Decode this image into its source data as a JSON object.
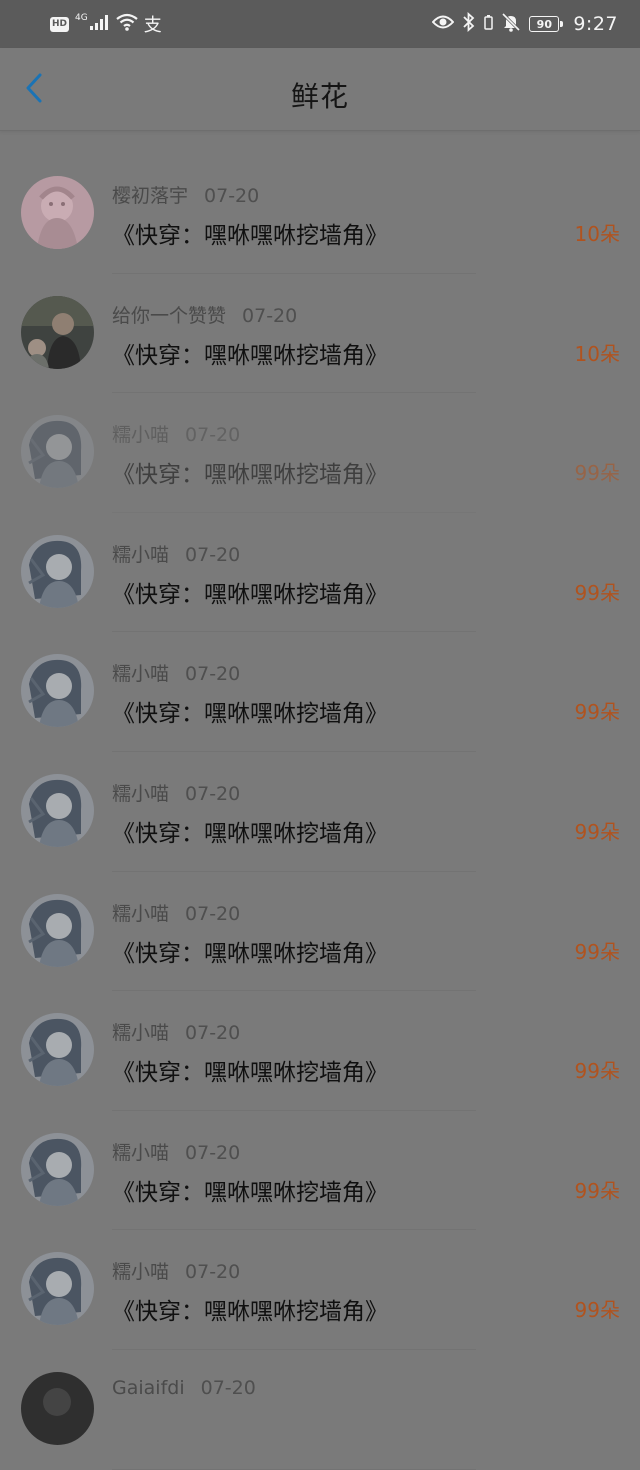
{
  "status_bar": {
    "hd": "HD",
    "network": "4G",
    "pay_glyph": "支",
    "battery": "90",
    "time": "9:27",
    "icons": [
      "signal-icon",
      "wifi-icon",
      "alipay-icon",
      "eye-icon",
      "bluetooth-icon",
      "mute-icon",
      "battery-icon"
    ]
  },
  "header": {
    "back_icon": "chevron-left-icon",
    "title": "鲜花"
  },
  "colors": {
    "accent": "#1a73b5",
    "amount": "#b0531f",
    "overlay_bg": "#7a7a7a"
  },
  "list": [
    {
      "user": "樱初落宇",
      "date": "07-20",
      "book": "《快穿：嘿咻嘿咻挖墙角》",
      "amount": "10朵",
      "avatar": "pink-anime-avatar"
    },
    {
      "user": "给你一个赞赞",
      "date": "07-20",
      "book": "《快穿：嘿咻嘿咻挖墙角》",
      "amount": "10朵",
      "avatar": "photo-avatar"
    },
    {
      "user": "糯小喵",
      "date": "07-20",
      "book": "《快穿：嘿咻嘿咻挖墙角》",
      "amount": "99朵",
      "avatar": "anime-girl-avatar"
    },
    {
      "user": "糯小喵",
      "date": "07-20",
      "book": "《快穿：嘿咻嘿咻挖墙角》",
      "amount": "99朵",
      "avatar": "anime-girl-avatar"
    },
    {
      "user": "糯小喵",
      "date": "07-20",
      "book": "《快穿：嘿咻嘿咻挖墙角》",
      "amount": "99朵",
      "avatar": "anime-girl-avatar"
    },
    {
      "user": "糯小喵",
      "date": "07-20",
      "book": "《快穿：嘿咻嘿咻挖墙角》",
      "amount": "99朵",
      "avatar": "anime-girl-avatar"
    },
    {
      "user": "糯小喵",
      "date": "07-20",
      "book": "《快穿：嘿咻嘿咻挖墙角》",
      "amount": "99朵",
      "avatar": "anime-girl-avatar"
    },
    {
      "user": "糯小喵",
      "date": "07-20",
      "book": "《快穿：嘿咻嘿咻挖墙角》",
      "amount": "99朵",
      "avatar": "anime-girl-avatar"
    },
    {
      "user": "糯小喵",
      "date": "07-20",
      "book": "《快穿：嘿咻嘿咻挖墙角》",
      "amount": "99朵",
      "avatar": "anime-girl-avatar"
    },
    {
      "user": "糯小喵",
      "date": "07-20",
      "book": "《快穿：嘿咻嘿咻挖墙角》",
      "amount": "99朵",
      "avatar": "anime-girl-avatar"
    },
    {
      "user": "Gaiaifdi",
      "date": "07-20",
      "book": "",
      "amount": "",
      "avatar": "dark-avatar"
    }
  ]
}
